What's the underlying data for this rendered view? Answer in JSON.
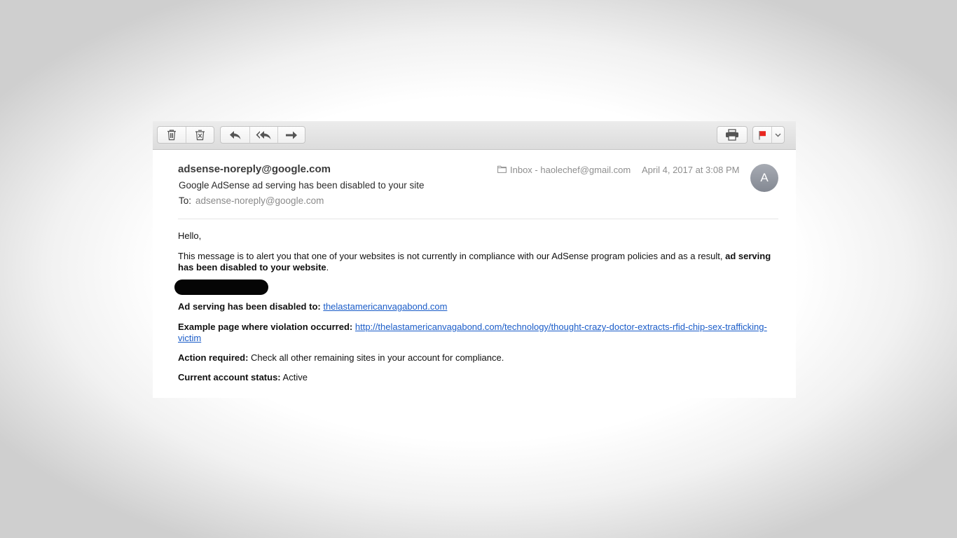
{
  "toolbar": {
    "icons": [
      "trash-icon",
      "junk-icon",
      "reply-icon",
      "reply-all-icon",
      "forward-icon",
      "print-icon",
      "flag-icon",
      "chevron-down-icon"
    ],
    "flag_color": "#e8261f"
  },
  "message": {
    "sender": "adsense-noreply@google.com",
    "subject": "Google AdSense ad serving has been disabled to your site",
    "to_label": "To:",
    "to_value": "adsense-noreply@google.com",
    "mailbox": "Inbox - haolechef@gmail.com",
    "date": "April 4, 2017 at 3:08 PM",
    "avatar_initial": "A"
  },
  "body": {
    "greeting": "Hello,",
    "alert_text": "This message is to alert you that one of your websites is not currently in compliance with our AdSense program policies and as a result, ",
    "alert_bold": "ad serving has been disabled to your website",
    "alert_end": ".",
    "disabled_label": "Ad serving has been disabled to:",
    "disabled_link": "thelastamericanvagabond.com",
    "example_label": "Example page where violation occurred:",
    "example_link": "http://thelastamericanvagabond.com/technology/thought-crazy-doctor-extracts-rfid-chip-sex-trafficking-victim",
    "action_label": "Action required:",
    "action_text": "Check all other remaining sites in your account for compliance.",
    "status_label": "Current account status:",
    "status_text": "Active"
  },
  "colors": {
    "link": "#1a5cc8",
    "avatar": "#979ba3"
  }
}
